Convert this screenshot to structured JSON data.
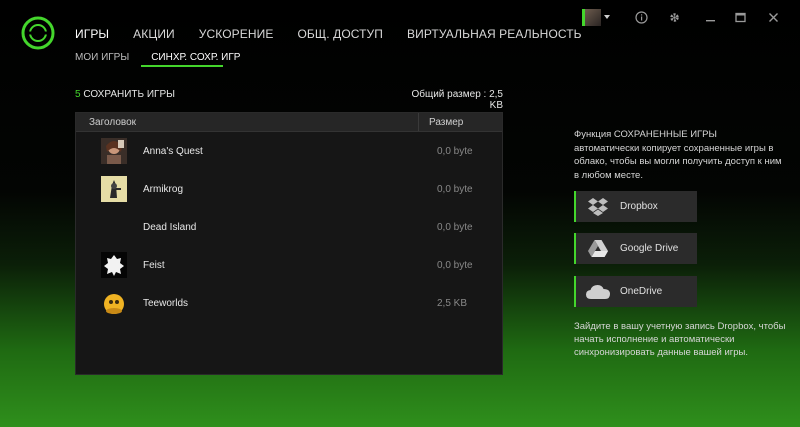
{
  "nav": {
    "top": [
      "ИГРЫ",
      "АКЦИИ",
      "УСКОРЕНИЕ",
      "ОБЩ. ДОСТУП",
      "ВИРТУАЛЬНАЯ РЕАЛЬНОСТЬ"
    ],
    "sub": [
      "МОИ ИГРЫ",
      "СИНХР. СОХР. ИГР"
    ]
  },
  "header": {
    "count": "5",
    "title": "СОХРАНИТЬ ИГРЫ",
    "total_size": "Общий размер : 2,5 KB"
  },
  "table": {
    "columns": [
      "Заголовок",
      "Размер"
    ],
    "rows": [
      {
        "name": "Anna's Quest",
        "size": "0,0 byte"
      },
      {
        "name": "Armikrog",
        "size": "0,0 byte"
      },
      {
        "name": "Dead Island",
        "size": "0,0 byte"
      },
      {
        "name": "Feist",
        "size": "0,0 byte"
      },
      {
        "name": "Teeworlds",
        "size": "2,5 KB"
      }
    ]
  },
  "side": {
    "description": "Функция СОХРАНЕННЫЕ ИГРЫ автоматически копирует сохраненные игры в облако, чтобы вы могли получить доступ к ним в любом месте.",
    "services": [
      "Dropbox",
      "Google Drive",
      "OneDrive"
    ],
    "hint": "Зайдите в вашу учетную запись Dropbox, чтобы начать исполнение и автоматически синхронизировать данные вашей игры."
  },
  "colors": {
    "accent": "#44d62c"
  }
}
